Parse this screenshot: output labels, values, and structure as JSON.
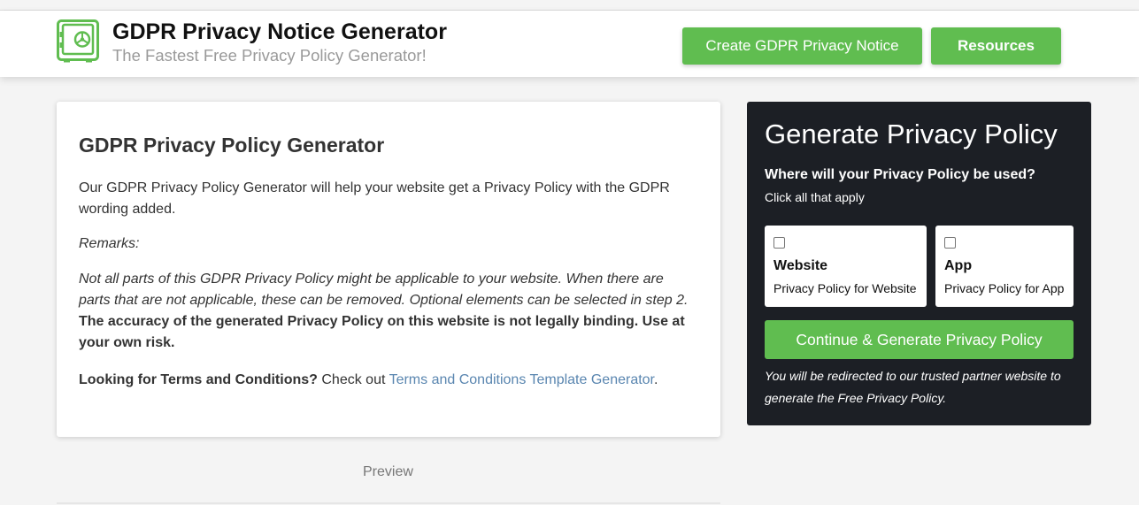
{
  "header": {
    "title": "GDPR Privacy Notice Generator",
    "subtitle": "The Fastest Free Privacy Policy Generator!",
    "logo_icon": "safe-icon",
    "create_button": "Create GDPR Privacy Notice",
    "resources_button": "Resources"
  },
  "main": {
    "heading": "GDPR Privacy Policy Generator",
    "intro": "Our GDPR Privacy Policy Generator will help your website get a Privacy Policy with the GDPR wording added.",
    "remarks": "Remarks:",
    "note_italic": "Not all parts of this GDPR Privacy Policy might be applicable to your website. When there are parts that are not applicable, these can be removed. Optional elements can be selected in step 2.",
    "note_bold": "The accuracy of the generated Privacy Policy on this website is not legally binding. Use at your own risk.",
    "terms_bold": "Looking for Terms and Conditions?",
    "terms_text": "Check out",
    "terms_link": "Terms and Conditions Template Generator",
    "terms_end": ".",
    "preview": "Preview"
  },
  "sidebar": {
    "title": "Generate Privacy Policy",
    "question": "Where will your Privacy Policy be used?",
    "hint": "Click all that apply",
    "options": [
      {
        "title": "Website",
        "subtitle": "Privacy Policy for Website",
        "checked": false
      },
      {
        "title": "App",
        "subtitle": "Privacy Policy for App",
        "checked": false
      }
    ],
    "continue_button": "Continue & Generate Privacy Policy",
    "redirect_note": "You will be redirected to our trusted partner website to generate the Free Privacy Policy."
  },
  "colors": {
    "accent": "#60bd50",
    "panel_bg": "#1c1f25",
    "link": "#5a86b0",
    "page_bg": "#f4f4f4"
  }
}
